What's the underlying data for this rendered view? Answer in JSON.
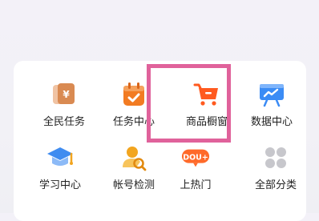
{
  "grid": {
    "items": [
      {
        "label": "全民任务",
        "icon": "ticket-stack-icon",
        "color": "#d98a52"
      },
      {
        "label": "任务中心",
        "icon": "calendar-check-icon",
        "color": "#f27b22"
      },
      {
        "label": "商品橱窗",
        "icon": "shopping-cart-icon",
        "color": "#ff5a1f"
      },
      {
        "label": "数据中心",
        "icon": "presentation-board-icon",
        "color": "#3b8cf5"
      },
      {
        "label": "学习中心",
        "icon": "graduation-cap-icon",
        "color": "#3f8cf0"
      },
      {
        "label": "帐号检测",
        "icon": "user-search-icon",
        "color": "#f2a51f"
      },
      {
        "label": "上热门",
        "icon": "dou-plus-icon",
        "color": "#ff6a2a",
        "badge_text": "DOU+"
      },
      {
        "label": "全部分类",
        "icon": "grid-dots-icon",
        "color": "#c7c7cc"
      }
    ]
  },
  "highlight": {
    "target": "商品橱窗",
    "color": "#e0629b"
  }
}
